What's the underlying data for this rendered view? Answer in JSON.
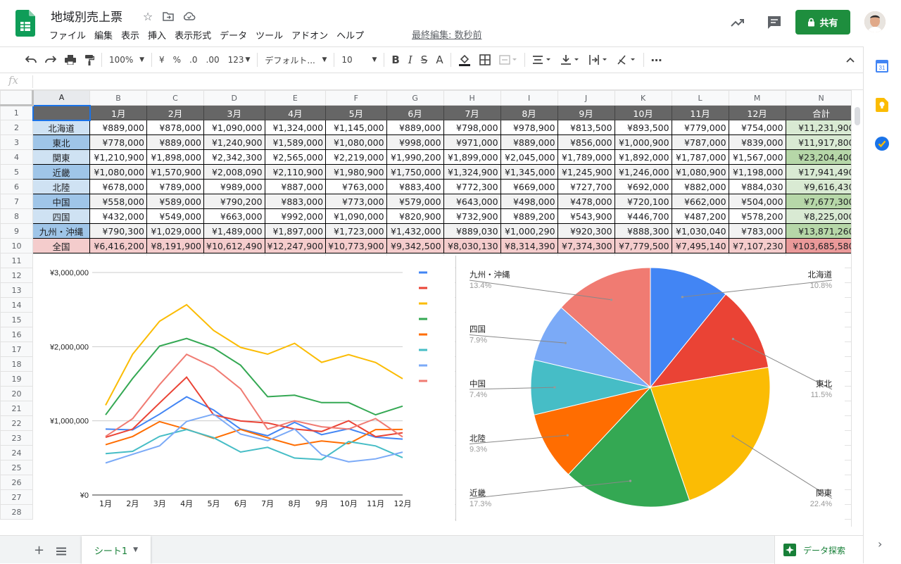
{
  "document": {
    "title": "地域別売上票",
    "last_edit": "最終編集: 数秒前"
  },
  "menu": [
    "ファイル",
    "編集",
    "表示",
    "挿入",
    "表示形式",
    "データ",
    "ツール",
    "アドオン",
    "ヘルプ"
  ],
  "share_label": "共有",
  "toolbar": {
    "zoom": "100%",
    "currency": "¥",
    "percent": "%",
    "dec_less": ".0",
    "dec_more": ".00",
    "format_more": "123",
    "font": "デフォルト...",
    "font_size": "10",
    "bold": "B",
    "italic": "I",
    "strike": "S",
    "text_color": "A"
  },
  "formula_label": "fx",
  "columns": [
    "A",
    "B",
    "C",
    "D",
    "E",
    "F",
    "G",
    "H",
    "I",
    "J",
    "K",
    "L",
    "M",
    "N"
  ],
  "header_row": [
    "",
    "1月",
    "2月",
    "3月",
    "4月",
    "5月",
    "6月",
    "7月",
    "8月",
    "9月",
    "10月",
    "11月",
    "12月",
    "合計"
  ],
  "rows": [
    [
      "北海道",
      "¥889,000",
      "¥878,000",
      "¥1,090,000",
      "¥1,324,000",
      "¥1,145,000",
      "¥889,000",
      "¥798,000",
      "¥978,900",
      "¥813,500",
      "¥893,500",
      "¥779,000",
      "¥754,000",
      "¥11,231,900"
    ],
    [
      "東北",
      "¥778,000",
      "¥889,000",
      "¥1,240,900",
      "¥1,589,000",
      "¥1,080,000",
      "¥998,000",
      "¥971,000",
      "¥889,000",
      "¥856,000",
      "¥1,000,900",
      "¥787,000",
      "¥839,000",
      "¥11,917,800"
    ],
    [
      "関東",
      "¥1,210,900",
      "¥1,898,000",
      "¥2,342,300",
      "¥2,565,000",
      "¥2,219,000",
      "¥1,990,200",
      "¥1,899,000",
      "¥2,045,000",
      "¥1,789,000",
      "¥1,892,000",
      "¥1,787,000",
      "¥1,567,000",
      "¥23,204,400"
    ],
    [
      "近畿",
      "¥1,080,000",
      "¥1,570,900",
      "¥2,008,090",
      "¥2,110,900",
      "¥1,980,900",
      "¥1,750,000",
      "¥1,324,900",
      "¥1,345,000",
      "¥1,245,900",
      "¥1,246,000",
      "¥1,080,900",
      "¥1,198,000",
      "¥17,941,490"
    ],
    [
      "北陸",
      "¥678,000",
      "¥789,000",
      "¥989,000",
      "¥887,000",
      "¥763,000",
      "¥883,400",
      "¥772,300",
      "¥669,000",
      "¥727,700",
      "¥692,000",
      "¥882,000",
      "¥884,030",
      "¥9,616,430"
    ],
    [
      "中国",
      "¥558,000",
      "¥589,000",
      "¥790,200",
      "¥883,000",
      "¥773,000",
      "¥579,000",
      "¥643,000",
      "¥498,000",
      "¥478,000",
      "¥720,100",
      "¥662,000",
      "¥504,000",
      "¥7,677,300"
    ],
    [
      "四国",
      "¥432,000",
      "¥549,000",
      "¥663,000",
      "¥992,000",
      "¥1,090,000",
      "¥820,900",
      "¥732,900",
      "¥889,200",
      "¥543,900",
      "¥446,700",
      "¥487,200",
      "¥578,200",
      "¥8,225,000"
    ],
    [
      "九州・沖縄",
      "¥790,300",
      "¥1,029,000",
      "¥1,489,000",
      "¥1,897,000",
      "¥1,723,000",
      "¥1,432,000",
      "¥889,030",
      "¥1,000,290",
      "¥920,300",
      "¥888,300",
      "¥1,030,040",
      "¥783,000",
      "¥13,871,260"
    ],
    [
      "全国",
      "¥6,416,200",
      "¥8,191,900",
      "¥10,612,490",
      "¥12,247,900",
      "¥10,773,900",
      "¥9,342,500",
      "¥8,030,130",
      "¥8,314,390",
      "¥7,374,300",
      "¥7,779,500",
      "¥7,495,140",
      "¥7,107,230",
      "¥103,685,580"
    ]
  ],
  "row_numbers": [
    "1",
    "2",
    "3",
    "4",
    "5",
    "6",
    "7",
    "8",
    "9",
    "10",
    "11",
    "12",
    "13",
    "14",
    "15",
    "16",
    "17",
    "18",
    "19",
    "20",
    "21",
    "22",
    "23",
    "24",
    "25",
    "26",
    "27",
    "28"
  ],
  "sheet_tab": "シート1",
  "explore_label": "データ探索",
  "colors": {
    "blue": "#4285f4",
    "red": "#ea4335",
    "yellow": "#fbbc04",
    "green": "#34a853",
    "orange": "#ff6d01",
    "teal": "#46bdc6",
    "lightblue": "#7baaf7",
    "salmon": "#f07b72"
  },
  "chart_data": [
    {
      "type": "line",
      "categories": [
        "1月",
        "2月",
        "3月",
        "4月",
        "5月",
        "6月",
        "7月",
        "8月",
        "9月",
        "10月",
        "11月",
        "12月"
      ],
      "ylim": [
        0,
        3000000
      ],
      "yticks": [
        "¥0",
        "¥1,000,000",
        "¥2,000,000",
        "¥3,000,000"
      ],
      "series": [
        {
          "color": "#4285f4",
          "values": [
            889000,
            878000,
            1090000,
            1324000,
            1145000,
            889000,
            798000,
            978900,
            813500,
            893500,
            779000,
            754000
          ]
        },
        {
          "color": "#ea4335",
          "values": [
            778000,
            889000,
            1240900,
            1589000,
            1080000,
            998000,
            971000,
            889000,
            856000,
            1000900,
            787000,
            839000
          ]
        },
        {
          "color": "#fbbc04",
          "values": [
            1210900,
            1898000,
            2342300,
            2565000,
            2219000,
            1990200,
            1899000,
            2045000,
            1789000,
            1892000,
            1787000,
            1567000
          ]
        },
        {
          "color": "#34a853",
          "values": [
            1080000,
            1570900,
            2008090,
            2110900,
            1980900,
            1750000,
            1324900,
            1345000,
            1245900,
            1246000,
            1080900,
            1198000
          ]
        },
        {
          "color": "#ff6d01",
          "values": [
            678000,
            789000,
            989000,
            887000,
            763000,
            883400,
            772300,
            669000,
            727700,
            692000,
            882000,
            884030
          ]
        },
        {
          "color": "#46bdc6",
          "values": [
            558000,
            589000,
            790200,
            883000,
            773000,
            579000,
            643000,
            498000,
            478000,
            720100,
            662000,
            504000
          ]
        },
        {
          "color": "#7baaf7",
          "values": [
            432000,
            549000,
            663000,
            992000,
            1090000,
            820900,
            732900,
            889200,
            543900,
            446700,
            487200,
            578200
          ]
        },
        {
          "color": "#f07b72",
          "values": [
            790300,
            1029000,
            1489000,
            1897000,
            1723000,
            1432000,
            889030,
            1000290,
            920300,
            888300,
            1030040,
            783000
          ]
        }
      ],
      "legend": "right"
    },
    {
      "type": "pie",
      "slices": [
        {
          "name": "北海道",
          "percent": "10.8%",
          "value": 11231900,
          "color": "#4285f4"
        },
        {
          "name": "東北",
          "percent": "11.5%",
          "value": 11917800,
          "color": "#ea4335"
        },
        {
          "name": "関東",
          "percent": "22.4%",
          "value": 23204400,
          "color": "#fbbc04"
        },
        {
          "name": "近畿",
          "percent": "17.3%",
          "value": 17941490,
          "color": "#34a853"
        },
        {
          "name": "北陸",
          "percent": "9.3%",
          "value": 9616430,
          "color": "#ff6d01"
        },
        {
          "name": "中国",
          "percent": "7.4%",
          "value": 7677300,
          "color": "#46bdc6"
        },
        {
          "name": "四国",
          "percent": "7.9%",
          "value": 8225000,
          "color": "#7baaf7"
        },
        {
          "name": "九州・沖縄",
          "percent": "13.4%",
          "value": 13871260,
          "color": "#f07b72"
        }
      ]
    }
  ]
}
